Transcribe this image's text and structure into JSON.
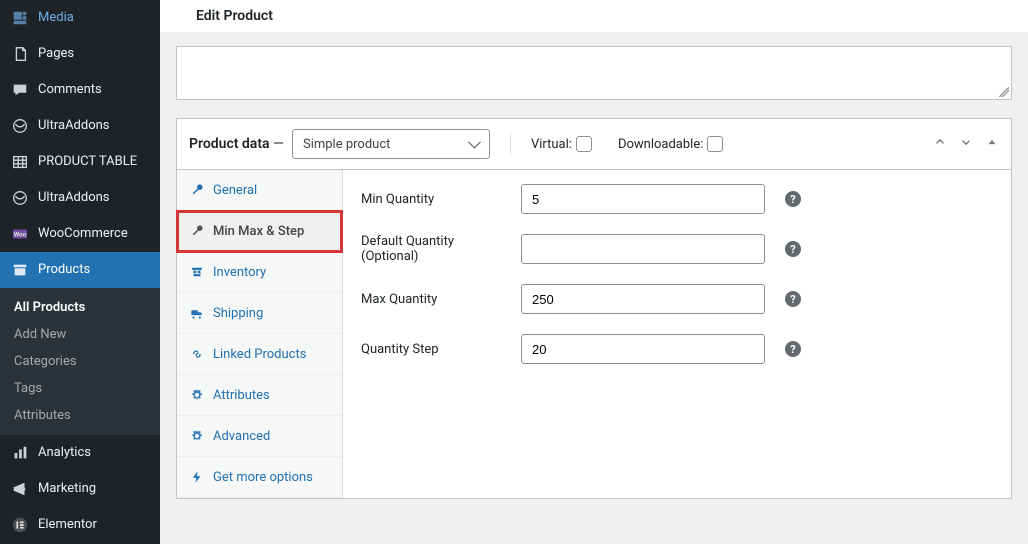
{
  "page": {
    "title": "Edit Product"
  },
  "sidebar": {
    "items": [
      {
        "label": "Media"
      },
      {
        "label": "Pages"
      },
      {
        "label": "Comments"
      },
      {
        "label": "UltraAddons"
      },
      {
        "label": "PRODUCT TABLE"
      },
      {
        "label": "UltraAddons"
      },
      {
        "label": "WooCommerce"
      },
      {
        "label": "Products"
      },
      {
        "label": "Analytics"
      },
      {
        "label": "Marketing"
      },
      {
        "label": "Elementor"
      }
    ],
    "submenu": [
      {
        "label": "All Products",
        "current": true
      },
      {
        "label": "Add New"
      },
      {
        "label": "Categories"
      },
      {
        "label": "Tags"
      },
      {
        "label": "Attributes"
      }
    ]
  },
  "product_data": {
    "heading": "Product data",
    "dash": " — ",
    "type_selected": "Simple product",
    "virtual_label": "Virtual:",
    "downloadable_label": "Downloadable:",
    "tabs": [
      {
        "label": "General"
      },
      {
        "label": "Min Max & Step"
      },
      {
        "label": "Inventory"
      },
      {
        "label": "Shipping"
      },
      {
        "label": "Linked Products"
      },
      {
        "label": "Attributes"
      },
      {
        "label": "Advanced"
      },
      {
        "label": "Get more options"
      }
    ],
    "fields": {
      "min_qty": {
        "label": "Min Quantity",
        "value": "5"
      },
      "def_qty": {
        "label": "Default Quantity (Optional)",
        "value": ""
      },
      "max_qty": {
        "label": "Max Quantity",
        "value": "250"
      },
      "step_qty": {
        "label": "Quantity Step",
        "value": "20"
      }
    },
    "help_glyph": "?"
  }
}
